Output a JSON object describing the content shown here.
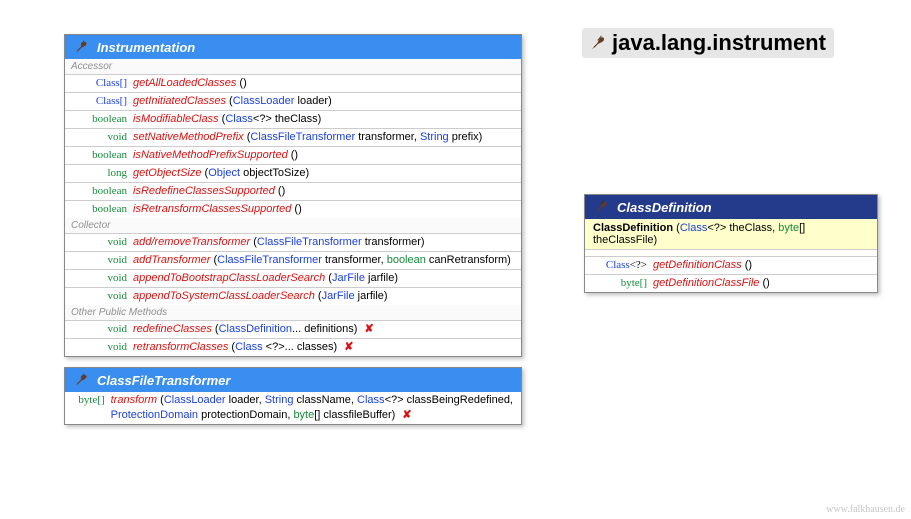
{
  "packageTitle": "java.lang.instrument",
  "footer": "www.falkhausen.de",
  "instrumentation": {
    "title": "Instrumentation",
    "sections": {
      "accessor": "Accessor",
      "collector": "Collector",
      "other": "Other Public Methods"
    },
    "accessor": [
      {
        "ret": "Class[]",
        "retLinked": true,
        "name": "getAllLoadedClasses",
        "params": " ()"
      },
      {
        "ret": "Class[]",
        "retLinked": true,
        "name": "getInitiatedClasses",
        "params": " (<span class='tl'>ClassLoader</span> loader)"
      },
      {
        "ret": "boolean",
        "name": "isModifiableClass",
        "params": " (<span class='tl'>Class</span><span class='sym'>&lt;?&gt;</span> theClass)"
      },
      {
        "ret": "void",
        "name": "setNativeMethodPrefix",
        "params": " (<span class='tl'>ClassFileTransformer</span> transformer, <span class='tl'>String</span> prefix)"
      },
      {
        "ret": "boolean",
        "name": "isNativeMethodPrefixSupported",
        "params": " ()"
      },
      {
        "ret": "long",
        "name": "getObjectSize",
        "params": " (<span class='tl'>Object</span> objectToSize)"
      },
      {
        "ret": "boolean",
        "name": "isRedefineClassesSupported",
        "params": " ()"
      },
      {
        "ret": "boolean",
        "name": "isRetransformClassesSupported",
        "params": " ()"
      }
    ],
    "collector": [
      {
        "ret": "void",
        "name": "add/removeTransformer",
        "params": " (<span class='tl'>ClassFileTransformer</span> transformer)"
      },
      {
        "ret": "void",
        "name": "addTransformer",
        "params": " (<span class='tl'>ClassFileTransformer</span> transformer, <span class='kw'>boolean</span> canRetransform)"
      },
      {
        "ret": "void",
        "name": "appendToBootstrapClassLoaderSearch",
        "params": " (<span class='tl'>JarFile</span> jarfile)"
      },
      {
        "ret": "void",
        "name": "appendToSystemClassLoaderSearch",
        "params": " (<span class='tl'>JarFile</span> jarfile)"
      }
    ],
    "other": [
      {
        "ret": "void",
        "name": "redefineClasses",
        "params": " (<span class='tl'>ClassDefinition</span>... definitions)",
        "throws": true
      },
      {
        "ret": "void",
        "name": "retransformClasses",
        "params": " (<span class='tl'>Class</span> <span class='sym'>&lt;?&gt;</span>... classes)",
        "throws": true
      }
    ]
  },
  "classFileTransformer": {
    "title": "ClassFileTransformer",
    "rows": [
      {
        "ret": "byte[]",
        "name": "transform",
        "params": " (<span class='tl'>ClassLoader</span> loader, <span class='tl'>String</span> className, <span class='tl'>Class</span><span class='sym'>&lt;?&gt;</span> classBeingRedefined,<br><span class='tl'>ProtectionDomain</span> protectionDomain, <span class='kw'>byte</span>[] classfileBuffer)",
        "throws": true
      }
    ]
  },
  "classDefinition": {
    "title": "ClassDefinition",
    "ctor": "<span class='ctor-name'>ClassDefinition</span> (<span class='tl'>Class</span><span class='sym'>&lt;?&gt;</span> theClass, <span class='kw'>byte</span>[] theClassFile)",
    "rows": [
      {
        "ret": "Class<?>",
        "retHtml": "<span class='tl'>Class</span><span class='sym'>&lt;?&gt;</span>",
        "name": "getDefinitionClass",
        "params": " ()"
      },
      {
        "ret": "byte[]",
        "retHtml": "<span class='kw'>byte</span>[]",
        "name": "getDefinitionClassFile",
        "params": " ()"
      }
    ]
  }
}
